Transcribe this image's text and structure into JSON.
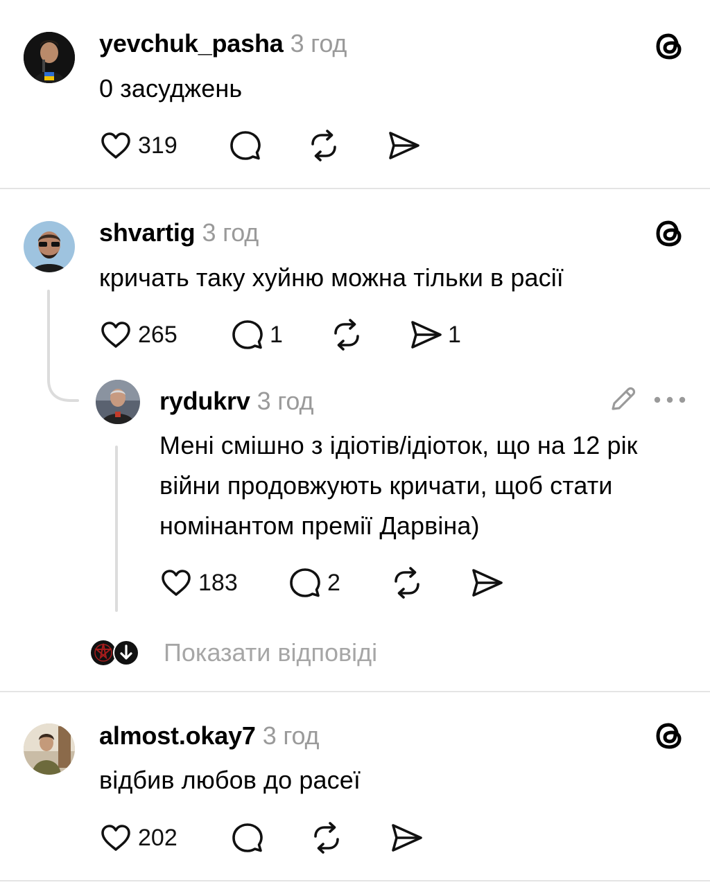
{
  "posts": [
    {
      "username": "yevchuk_pasha",
      "time": "3 год",
      "text": "0 засуджень",
      "likes": "319",
      "comments": "",
      "reposts": "",
      "shares": ""
    },
    {
      "username": "shvartig",
      "time": "3 год",
      "text": "кричать таку хуйню можна тільки в расії",
      "likes": "265",
      "comments": "1",
      "reposts": "",
      "shares": "1"
    },
    {
      "username": "almost.okay7",
      "time": "3 год",
      "text": "відбив любов до расеї",
      "likes": "202",
      "comments": "",
      "reposts": "",
      "shares": ""
    }
  ],
  "reply": {
    "username": "rydukrv",
    "time": "3 год",
    "text": "Мені смішно з ідіотів/ідіоток, що на 12 рік війни продовжують кричати, щоб стати номінантом премії Дарвіна)",
    "likes": "183",
    "comments": "2",
    "reposts": "",
    "shares": ""
  },
  "show_replies_label": "Показати відповіді",
  "icons": {
    "like": "heart-icon",
    "comment": "speech-bubble-icon",
    "repost": "repost-icon",
    "share": "send-icon",
    "brand": "threads-logo-icon",
    "edit": "pencil-icon",
    "more": "more-icon",
    "expand": "arrow-down-icon"
  },
  "colors": {
    "text": "#000000",
    "muted": "#9a9a9a",
    "divider": "#e4e4e4",
    "thread_line": "#dcdcdc"
  }
}
